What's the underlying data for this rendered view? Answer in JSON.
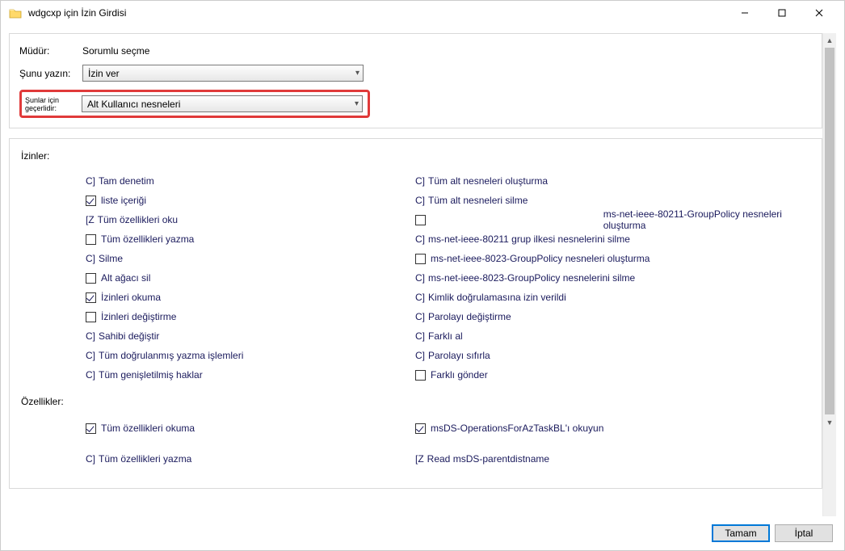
{
  "window": {
    "title": "wdgcxp için İzin Girdisi"
  },
  "top": {
    "principal_label": "Müdür:",
    "principal_value": "Sorumlu seçme",
    "type_label": "Şunu yazın:",
    "type_value": "İzin ver",
    "applies_label": "Şunlar için geçerlidir:",
    "applies_value": "Alt Kullanıcı nesneleri"
  },
  "sections": {
    "permissions_label": "İzinler:",
    "properties_label": "Özellikler:"
  },
  "perm_left": [
    {
      "prefix": "C]",
      "label": "Tam denetim",
      "state": "none"
    },
    {
      "prefix": "",
      "label": "liste içeriği",
      "state": "checked"
    },
    {
      "prefix": "[Z",
      "label": "Tüm özellikleri oku",
      "state": "none"
    },
    {
      "prefix": "",
      "label": "Tüm özellikleri yazma",
      "state": "empty"
    },
    {
      "prefix": "C]",
      "label": "Silme",
      "state": "none"
    },
    {
      "prefix": "",
      "label": "Alt ağacı sil",
      "state": "empty"
    },
    {
      "prefix": "",
      "label": "İzinleri okuma",
      "state": "checked"
    },
    {
      "prefix": "",
      "label": "İzinleri değiştirme",
      "state": "empty"
    },
    {
      "prefix": "C]",
      "label": "Sahibi değiştir",
      "state": "none"
    },
    {
      "prefix": "C]",
      "label": "Tüm doğrulanmış yazma işlemleri",
      "state": "none"
    },
    {
      "prefix": "C]",
      "label": "Tüm genişletilmiş haklar",
      "state": "none"
    }
  ],
  "perm_right": [
    {
      "prefix": "C]",
      "label": "Tüm alt nesneleri oluşturma",
      "state": "none"
    },
    {
      "prefix": "C]",
      "label": "Tüm alt nesneleri silme",
      "state": "none"
    },
    {
      "prefix": "",
      "label": "ms-net-ieee-80211-GroupPolicy nesneleri oluşturma",
      "state": "empty-far"
    },
    {
      "prefix": "C]",
      "label": "ms-net-ieee-80211 grup ilkesi nesnelerini silme",
      "state": "none"
    },
    {
      "prefix": "",
      "label": "ms-net-ieee-8023-GroupPolicy nesneleri oluşturma",
      "state": "empty"
    },
    {
      "prefix": "C]",
      "label": "ms-net-ieee-8023-GroupPolicy nesnelerini silme",
      "state": "none"
    },
    {
      "prefix": "C]",
      "label": "Kimlik doğrulamasına izin verildi",
      "state": "none"
    },
    {
      "prefix": "C]",
      "label": "Parolayı değiştirme",
      "state": "none"
    },
    {
      "prefix": "C]",
      "label": "Farklı al",
      "state": "none"
    },
    {
      "prefix": "C]",
      "label": "Parolayı sıfırla",
      "state": "none"
    },
    {
      "prefix": "",
      "label": "Farklı gönder",
      "state": "empty"
    }
  ],
  "prop_left": [
    {
      "prefix": "",
      "label": "Tüm özellikleri okuma",
      "state": "checked"
    },
    {
      "prefix": "C]",
      "label": "Tüm özellikleri yazma",
      "state": "none"
    }
  ],
  "prop_right": [
    {
      "prefix": "",
      "label": "msDS-OperationsForAzTaskBL'ı okuyun",
      "state": "checked"
    },
    {
      "prefix": "[Z",
      "label": "Read msDS-parentdistname",
      "state": "none"
    }
  ],
  "footer": {
    "ok": "Tamam",
    "cancel": "İptal"
  }
}
